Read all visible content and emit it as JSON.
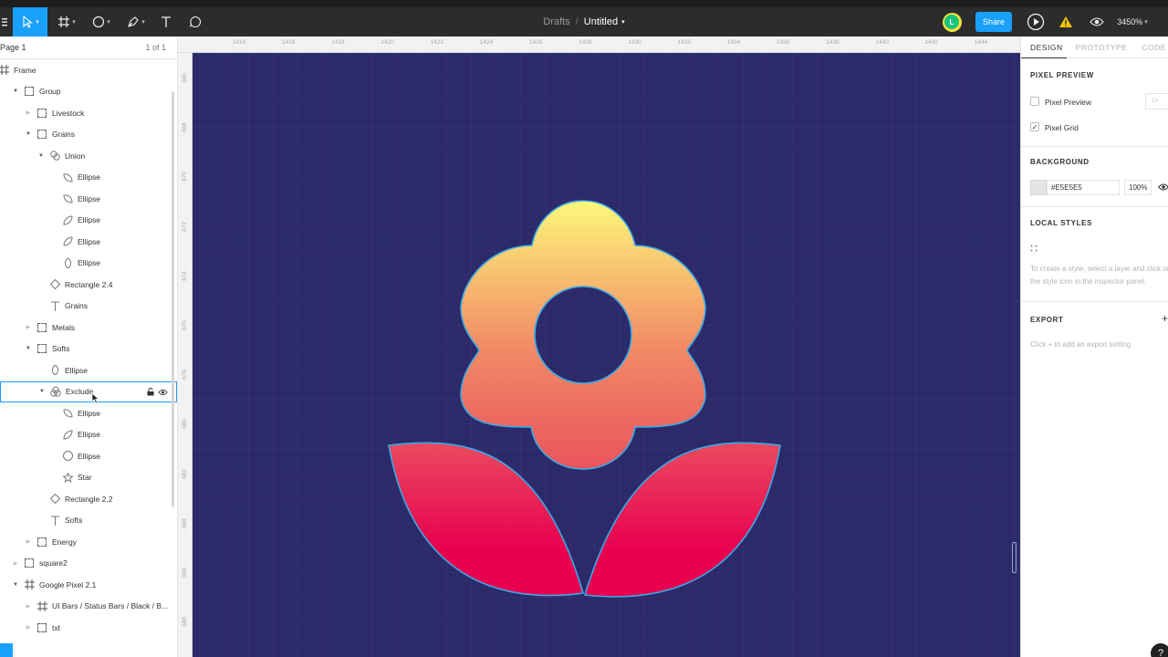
{
  "toolbar": {
    "menu_icon": "hamburger-icon",
    "tools": [
      "move-tool",
      "frame-tool",
      "shape-tool",
      "pen-tool",
      "text-tool",
      "comment-tool"
    ],
    "breadcrumb_parent": "Drafts",
    "breadcrumb_sep": "/",
    "file_name": "Untitled",
    "avatar_initial": "L",
    "share_label": "Share",
    "zoom": "3450%",
    "accent": "#18a0fb"
  },
  "left_panel": {
    "page_name": "Page 1",
    "page_count": "1 of 1",
    "layers": [
      {
        "label": "Frame",
        "icon": "frame",
        "depth": 0,
        "arrow": "none"
      },
      {
        "label": "Group",
        "icon": "group",
        "depth": 1,
        "arrow": "open"
      },
      {
        "label": "Livestock",
        "icon": "group",
        "depth": 2,
        "arrow": "closed"
      },
      {
        "label": "Grains",
        "icon": "group",
        "depth": 2,
        "arrow": "open"
      },
      {
        "label": "Union",
        "icon": "union",
        "depth": 3,
        "arrow": "open"
      },
      {
        "label": "Ellipse",
        "icon": "leaf",
        "depth": 4,
        "arrow": "none"
      },
      {
        "label": "Ellipse",
        "icon": "leaf",
        "depth": 4,
        "arrow": "none"
      },
      {
        "label": "Ellipse",
        "icon": "leaf2",
        "depth": 4,
        "arrow": "none"
      },
      {
        "label": "Ellipse",
        "icon": "leaf2",
        "depth": 4,
        "arrow": "none"
      },
      {
        "label": "Ellipse",
        "icon": "oval",
        "depth": 4,
        "arrow": "none"
      },
      {
        "label": "Rectangle 2.4",
        "icon": "diamond",
        "depth": 3,
        "arrow": "none"
      },
      {
        "label": "Grains",
        "icon": "text",
        "depth": 3,
        "arrow": "none"
      },
      {
        "label": "Metals",
        "icon": "group",
        "depth": 2,
        "arrow": "closed"
      },
      {
        "label": "Softs",
        "icon": "group",
        "depth": 2,
        "arrow": "open"
      },
      {
        "label": "Ellipse",
        "icon": "oval",
        "depth": 3,
        "arrow": "none"
      },
      {
        "label": "Exclude",
        "icon": "exclude",
        "depth": 3,
        "arrow": "open",
        "selected": true
      },
      {
        "label": "Ellipse",
        "icon": "leaf",
        "depth": 4,
        "arrow": "none"
      },
      {
        "label": "Ellipse",
        "icon": "leaf2",
        "depth": 4,
        "arrow": "none"
      },
      {
        "label": "Ellipse",
        "icon": "circle",
        "depth": 4,
        "arrow": "none"
      },
      {
        "label": "Star",
        "icon": "star",
        "depth": 4,
        "arrow": "none"
      },
      {
        "label": "Rectangle 2.2",
        "icon": "diamond",
        "depth": 3,
        "arrow": "none"
      },
      {
        "label": "Softs",
        "icon": "text",
        "depth": 3,
        "arrow": "none"
      },
      {
        "label": "Energy",
        "icon": "group",
        "depth": 2,
        "arrow": "closed"
      },
      {
        "label": "square2",
        "icon": "group",
        "depth": 1,
        "arrow": "closed"
      },
      {
        "label": "Google Pixel 2.1",
        "icon": "frame",
        "depth": 1,
        "arrow": "open"
      },
      {
        "label": "UI Bars / Status Bars / Black / B...",
        "icon": "frame",
        "depth": 2,
        "arrow": "closed"
      },
      {
        "label": "txt",
        "icon": "group",
        "depth": 2,
        "arrow": "closed"
      }
    ]
  },
  "rulers": {
    "top": [
      "1414",
      "1416",
      "1418",
      "1420",
      "1422",
      "1424",
      "1426",
      "1428",
      "1430",
      "1432",
      "1434",
      "1436",
      "1438",
      "1440",
      "1442",
      "1444"
    ],
    "left": [
      "666",
      "668",
      "670",
      "672",
      "674",
      "676",
      "678",
      "680",
      "682",
      "684",
      "686",
      "688"
    ]
  },
  "canvas": {
    "background": "#2d2a6a",
    "flower_top": "#fdf77a",
    "flower_mid": "#f28a66",
    "flower_bottom": "#e9545c",
    "leaf_top": "#ea4a5e",
    "leaf_bottom": "#e8004f",
    "outline": "#39a9e8"
  },
  "right_panel": {
    "tabs": [
      "DESIGN",
      "PROTOTYPE",
      "CODE"
    ],
    "pixel_preview_heading": "PIXEL PREVIEW",
    "pixel_preview_label": "Pixel Preview",
    "pixel_preview_scale": "1x",
    "pixel_grid_label": "Pixel Grid",
    "background_heading": "BACKGROUND",
    "background_hex": "#E5E5E5",
    "background_opacity": "100%",
    "background_color": "#e5e5e5",
    "local_styles_heading": "LOCAL STYLES",
    "local_styles_hint": "To create a style, select a layer and click on the style icon in the inspector panel.",
    "export_heading": "EXPORT",
    "export_hint": "Click + to add an export setting"
  }
}
